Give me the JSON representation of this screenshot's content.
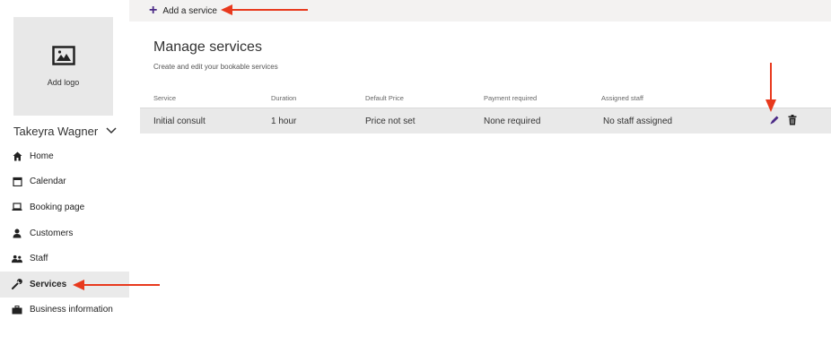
{
  "sidebar": {
    "logo_label": "Add logo",
    "user_name": "Takeyra Wagner",
    "items": [
      {
        "label": "Home",
        "icon": "home-icon"
      },
      {
        "label": "Calendar",
        "icon": "calendar-icon"
      },
      {
        "label": "Booking page",
        "icon": "laptop-icon"
      },
      {
        "label": "Customers",
        "icon": "person-icon"
      },
      {
        "label": "Staff",
        "icon": "people-icon"
      },
      {
        "label": "Services",
        "icon": "wrench-icon",
        "active": true
      },
      {
        "label": "Business information",
        "icon": "briefcase-icon"
      }
    ]
  },
  "toolbar": {
    "add_service_label": "Add a service"
  },
  "main": {
    "title": "Manage services",
    "subtitle": "Create and edit your bookable services",
    "columns": [
      "Service",
      "Duration",
      "Default Price",
      "Payment required",
      "Assigned staff"
    ],
    "rows": [
      {
        "service": "Initial consult",
        "duration": "1 hour",
        "price": "Price not set",
        "payment": "None required",
        "staff": "No staff assigned"
      }
    ]
  },
  "colors": {
    "accent": "#4b2a86",
    "annotation_arrow": "#e8391d",
    "active_nav": "#eaeaea",
    "row_bg": "#e9e9e9"
  }
}
